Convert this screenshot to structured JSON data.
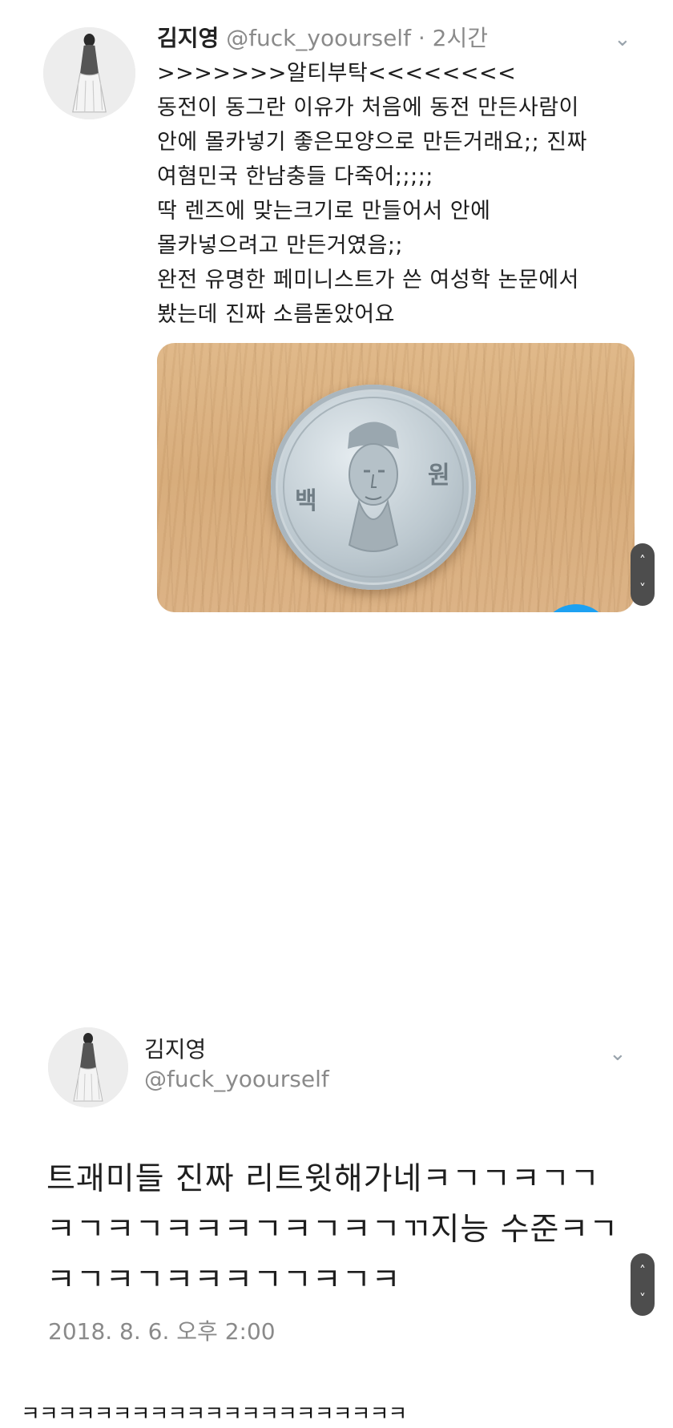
{
  "tweet1": {
    "name": "김지영",
    "handle": "@fuck_yoourself",
    "separator": "·",
    "time": "2시간",
    "lines": [
      ">>>>>>>알티부탁<<<<<<<<",
      "동전이 동그란 이유가 처음에 동전 만든사람이",
      "안에 몰카넣기 좋은모양으로 만든거래요;; 진짜",
      "여혐민국 한남충들 다죽어;;;;;",
      "딱 렌즈에 맞는크기로 만들어서 안에",
      "몰카넣으려고 만든거였음;;",
      "완전 유명한 페미니스트가 쓴 여성학 논문에서",
      "봤는데 진짜 소름돋았어요"
    ],
    "coin_chars": {
      "left": "백",
      "right": "원"
    },
    "icons": {
      "menu": "chevron-down-icon"
    }
  },
  "tweet2": {
    "name": "김지영",
    "handle": "@fuck_yoourself",
    "lines": [
      "트괘미들 진짜 리트윗해가네ㅋㄱㄱㅋㄱㄱ",
      "ㅋㄱㅋㄱㅋㅋㅋㄱㅋㄱㅋㄱㄲ지능 수준ㅋㄱ",
      "ㅋㄱㅋㄱㅋㅋㅋㄱㄱㅋㄱㅋ"
    ],
    "date": "2018. 8. 6. 오후 2:00"
  },
  "caption": "ㅋㅋㅋㅋㅋㅋㅋㅋㅋㅋㅋㅋㅋㅋㅋㅋㅋㅋㅋㅋㅋ",
  "scroll_controls": {
    "up": "˄",
    "down": "˅"
  },
  "colors": {
    "accent": "#1da1f2",
    "muted": "#8a8a8a",
    "text": "#1e1e1e"
  }
}
